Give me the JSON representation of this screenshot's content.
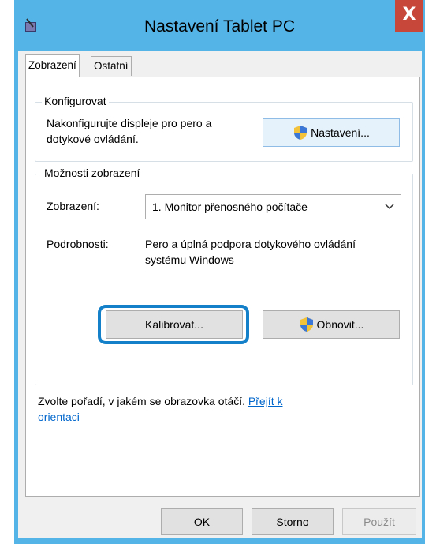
{
  "window": {
    "title": "Nastavení Tablet PC",
    "close_glyph": "X",
    "icon": "tablet-pen-icon"
  },
  "tabs": [
    {
      "label": "Zobrazení",
      "active": true
    },
    {
      "label": "Ostatní",
      "active": false
    }
  ],
  "configure": {
    "legend": "Konfigurovat",
    "text_line1": "Nakonfigurujte displeje pro pero a",
    "text_line2": "dotykové ovládání.",
    "button_label": "Nastavení...",
    "button_icon": "uac-shield-icon"
  },
  "display_options": {
    "legend": "Možnosti zobrazení",
    "display_label": "Zobrazení:",
    "display_value": "1. Monitor přenosného počítače",
    "details_label": "Podrobnosti:",
    "details_line1": "Pero a úplná podpora dotykového ovládání",
    "details_line2": "systému Windows",
    "calibrate_label": "Kalibrovat...",
    "reset_label": "Obnovit...",
    "reset_icon": "uac-shield-icon"
  },
  "orientation": {
    "text": "Zvolte pořadí, v jakém se obrazovka otáčí. ",
    "link_part1": "Přejít k",
    "link_part2": "orientaci"
  },
  "footer": {
    "ok_label": "OK",
    "cancel_label": "Storno",
    "apply_label": "Použít"
  },
  "colors": {
    "titlebar": "#54b4e8",
    "close": "#c7473b",
    "highlight": "#1380c9",
    "link": "#0066cc"
  }
}
